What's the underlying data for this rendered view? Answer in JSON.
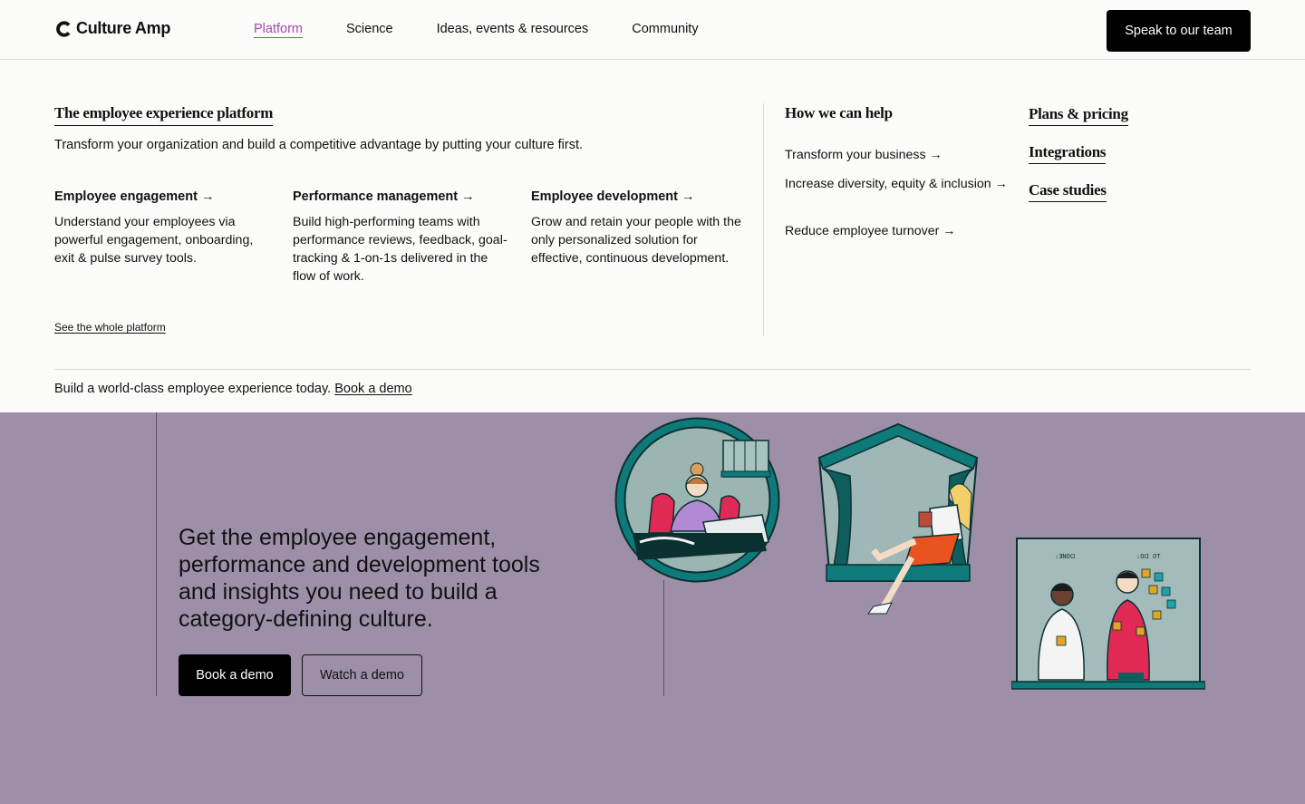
{
  "header": {
    "brand": "Culture Amp",
    "nav": [
      "Platform",
      "Science",
      "Ideas, events & resources",
      "Community"
    ],
    "cta": "Speak to our team"
  },
  "menu": {
    "title": "The employee experience platform",
    "description": "Transform your organization and build a competitive advantage by putting your culture first.",
    "products": [
      {
        "title": "Employee engagement →",
        "description": "Understand your employees via powerful engagement, onboarding, exit & pulse survey tools."
      },
      {
        "title": "Performance management →",
        "description": "Build high-performing teams with performance reviews, feedback, goal-tracking & 1-on-1s delivered in the flow of work."
      },
      {
        "title": "Employee development →",
        "description": "Grow and retain your people with the only personalized solution for effective, continuous development."
      }
    ],
    "see_all": "See the whole platform",
    "help": {
      "title": "How we can help",
      "links": [
        "Transform your business →",
        "Increase diversity, equity & inclusion →",
        "Reduce employee turnover →"
      ]
    },
    "side_links": [
      "Plans & pricing",
      "Integrations",
      "Case studies"
    ],
    "footer_text": "Build a world-class employee experience today.",
    "footer_link": "Book a demo"
  },
  "hero": {
    "headline": "Get the employee engagement, performance and development tools and insights you need to build a category-defining culture.",
    "primary_button": "Book a demo",
    "secondary_button": "Watch a demo",
    "whiteboard_left": ":ƎNOᗡ",
    "whiteboard_right": ":Oᗡ OT"
  },
  "colors": {
    "accent": "#a54ab0",
    "hero_bg": "#9d8fa8",
    "teal": "#0e6b6b"
  }
}
